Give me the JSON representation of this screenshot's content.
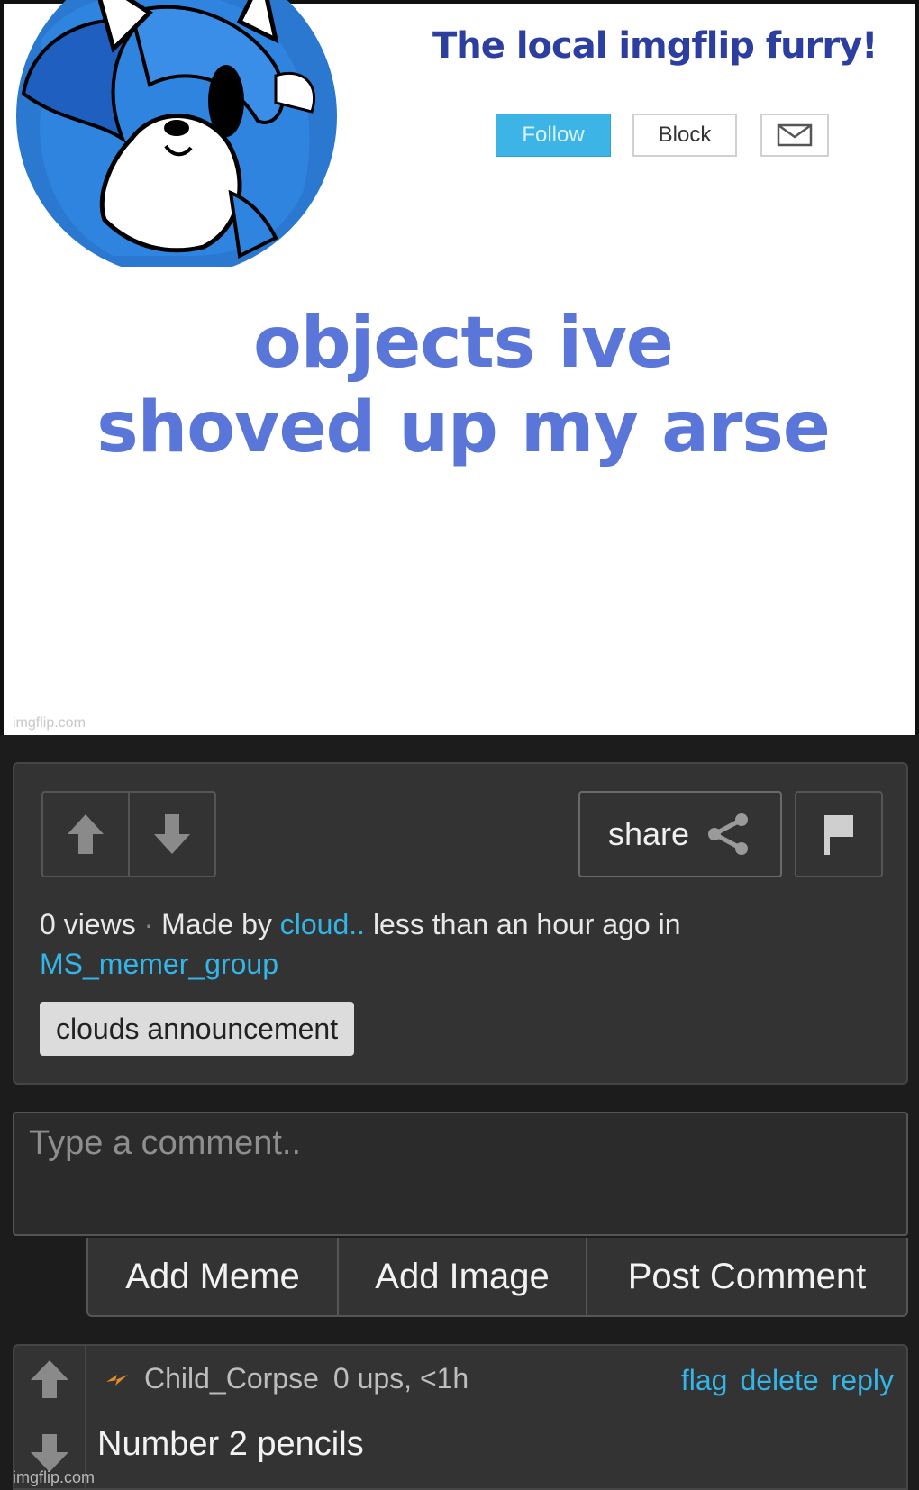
{
  "meme": {
    "tagline": "The local imgflip furry!",
    "follow_label": "Follow",
    "block_label": "Block",
    "headline_line1": "objects ive",
    "headline_line2": "shoved up my arse",
    "watermark": "imgflip.com"
  },
  "post": {
    "share_label": "share",
    "views": "0 views",
    "separator": "·",
    "made_by_prefix": "Made by",
    "author": "cloud..",
    "time_text": "less than an hour ago in",
    "stream": "MS_memer_group",
    "tag": "clouds announcement"
  },
  "comment_box": {
    "placeholder": "Type a comment..",
    "add_meme_label": "Add Meme",
    "add_image_label": "Add Image",
    "post_comment_label": "Post Comment"
  },
  "comment": {
    "username": "Child_Corpse",
    "stats": "0 ups, <1h",
    "flag_label": "flag",
    "delete_label": "delete",
    "reply_label": "reply",
    "text": "Number 2 pencils"
  },
  "footer": {
    "watermark": "imgflip.com"
  },
  "icons": {
    "upvote": "arrow-up-icon",
    "downvote": "arrow-down-icon",
    "share": "share-icon",
    "flag": "flag-icon",
    "mail": "envelope-icon",
    "badge": "lightning-badge-icon"
  },
  "colors": {
    "link": "#33b5e8",
    "follow": "#3cb4e6",
    "headline": "#5a76d8",
    "tagline": "#2c3fa0",
    "panel": "#333333"
  }
}
